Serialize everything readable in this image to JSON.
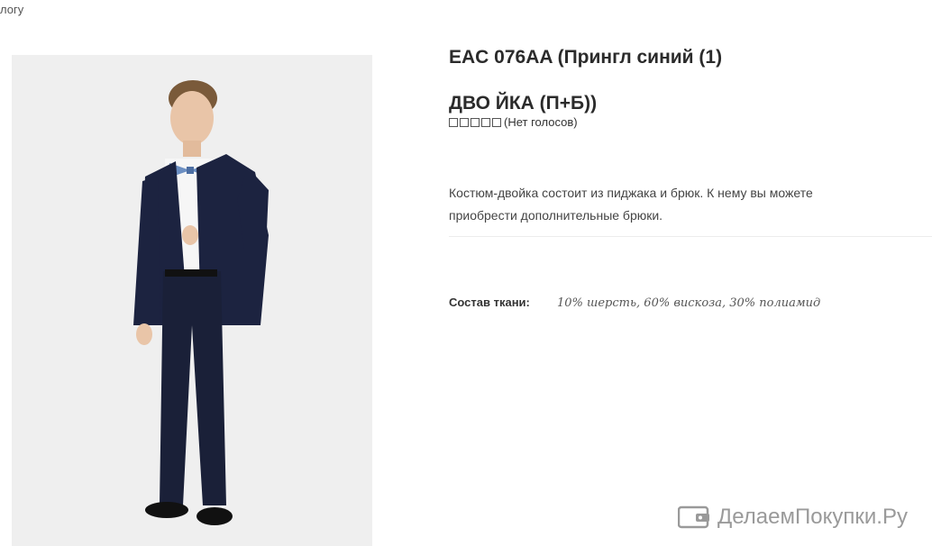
{
  "breadcrumb": "логу",
  "product": {
    "title_line1": "EAC 076AA (Прингл синий (1)",
    "title_line2": "ДВО ЙКА (П+Б))",
    "rating": {
      "stars_filled": 0,
      "stars_total": 5,
      "votes_text": "(Нет голосов)"
    },
    "description_line1": "Костюм-двойка состоит из пиджака и брюк. К нему вы можете",
    "description_line2": "приобрести  дополнительные брюки.",
    "composition_label": "Состав ткани:",
    "composition_value": "10% шерсть, 60% вискоза, 30% полиамид"
  },
  "watermark": {
    "text": "ДелаемПокупки.Ру",
    "icon": "wallet-icon"
  },
  "colors": {
    "suit": "#1c2340",
    "shirt": "#f6f6f6",
    "bowtie": "#6c8fc2",
    "photo_bg": "#efefef",
    "watermark": "#9a9a9a"
  }
}
